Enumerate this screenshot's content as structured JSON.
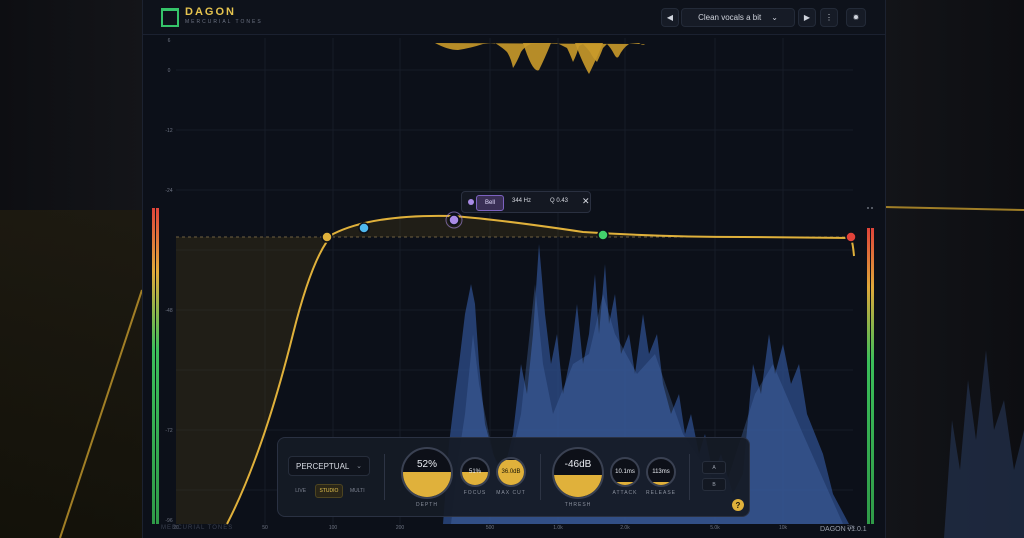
{
  "app": {
    "title": "DAGON",
    "subtitle": "MERCURIAL TONES",
    "version": "DAGON v1.0.1",
    "watermark": "MERCURIAL TONES"
  },
  "header": {
    "prev_label": "◀",
    "next_label": "▶",
    "preset_name": "Clean vocals a bit",
    "preset_chevron": "⌄",
    "menu_label": "⋮",
    "settings_label": "✹"
  },
  "graph": {
    "db_labels": [
      "6",
      "0",
      "-12",
      "-24",
      "-48",
      "-72",
      "-96"
    ],
    "freq_labels": [
      "20",
      "50",
      "100",
      "200",
      "500",
      "1.0k",
      "2.0k",
      "5.0k",
      "10k",
      "20k"
    ],
    "selected_band": {
      "type": "Bell",
      "freq": "344 Hz",
      "q": "Q 0.43",
      "close": "✕"
    },
    "band_colors": [
      "#e0b13b",
      "#4fb8ee",
      "#a98be6",
      "#43d06b",
      "#e2433a"
    ]
  },
  "controls": {
    "mode_dropdown": "PERCEPTUAL",
    "modes": [
      "LIVE",
      "STUDIO",
      "MULTI"
    ],
    "active_mode": "STUDIO",
    "depth": {
      "value": "52%",
      "label": "DEPTH",
      "level": 0.52
    },
    "focus": {
      "value": "51%",
      "label": "FOCUS",
      "level": 0.51
    },
    "max_cut": {
      "value": "36.0dB",
      "label": "MAX CUT",
      "level": 0.95
    },
    "thresh": {
      "value": "-46dB",
      "label": "THRESH",
      "level": 0.45
    },
    "attack": {
      "value": "10.1ms",
      "label": "ATTACK",
      "level": 0.1
    },
    "release": {
      "value": "113ms",
      "label": "RELEASE",
      "level": 0.1
    },
    "ab_a": "A",
    "ab_b": "B",
    "help": "?"
  },
  "colors": {
    "accent": "#e0b13b",
    "spectrum": "#3a5a96",
    "meter_green": "#3bbf5a",
    "meter_red": "#e0443a"
  }
}
